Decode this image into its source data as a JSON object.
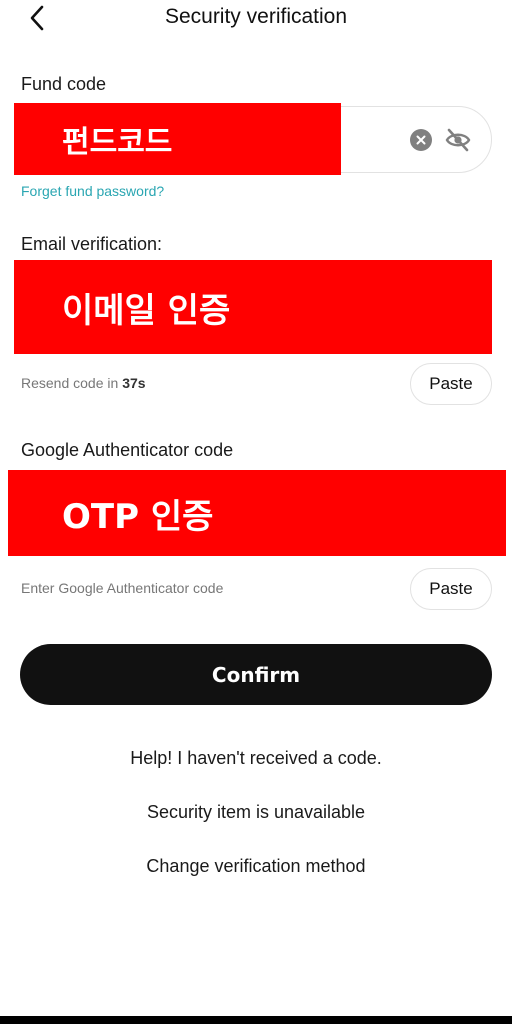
{
  "header": {
    "title": "Security verification",
    "back_icon": "chevron-left-icon"
  },
  "fund_code": {
    "label": "Fund code",
    "redacted_text": "펀드코드",
    "clear_icon": "clear-icon",
    "visibility_icon": "eye-off-icon",
    "forgot_link": "Forget fund password?"
  },
  "email": {
    "label": "Email verification:",
    "redacted_text": "이메일 인증",
    "resend_prefix": "Resend code in ",
    "resend_seconds": "37s",
    "paste_label": "Paste"
  },
  "google_auth": {
    "label": "Google Authenticator code",
    "redacted_text": "OTP 인증",
    "placeholder_hint": "Enter Google Authenticator code",
    "paste_label": "Paste"
  },
  "confirm_label": "Confirm",
  "footer_links": [
    "Help! I haven't received a code.",
    "Security item is unavailable",
    "Change verification method"
  ],
  "colors": {
    "redaction": "#ff0000",
    "primary_button": "#111111",
    "link": "#2aa6b2"
  }
}
